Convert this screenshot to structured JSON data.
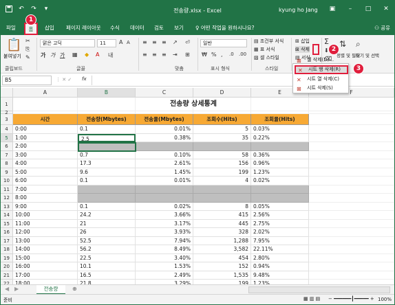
{
  "titlebar": {
    "title": "전송량.xlsx  -  Excel",
    "user": "kyung ho Jang",
    "save_icon": "save-icon",
    "undo_icon": "undo-icon",
    "redo_icon": "redo-icon"
  },
  "tabs": [
    "파일",
    "홈",
    "삽입",
    "페이지 레이아웃",
    "수식",
    "데이터",
    "검토",
    "보기"
  ],
  "tell_me": "어떤 작업을 원하시나요?",
  "share": "공유",
  "ribbon": {
    "paste": "붙여넣기",
    "clipboard": "클립보드",
    "font_name": "맑은 고딕",
    "font_size": "11",
    "font_group": "글꼴",
    "align_group": "맞춤",
    "number_format": "일반",
    "number_group": "표시 형식",
    "cond_format": "조건부 서식",
    "table_format": "표 서식",
    "cell_style": "셀 스타일",
    "style_group": "스타일",
    "insert": "삽입",
    "delete": "삭제",
    "format": "서식",
    "sum": "Σ",
    "sort_filter": "정렬 및 필터",
    "find_select": "찾기 및 선택"
  },
  "delete_menu": {
    "items": [
      "셀 삭제(D)...",
      "시트 행 삭제(R)",
      "시트 열 삭제(C)",
      "시트 삭제(S)"
    ]
  },
  "callouts": [
    "1",
    "2",
    "3"
  ],
  "formula_bar": {
    "name_box": "B5",
    "fx": "fx"
  },
  "columns": [
    "A",
    "B",
    "C",
    "D",
    "E",
    "F"
  ],
  "sheet": {
    "title": "전송량 상세통계",
    "headers": [
      "시간",
      "전송량(Mbytes)",
      "전송율(Mbytes)",
      "조회수(Hits)",
      "조회율(Hits)"
    ],
    "rows": [
      [
        "0:00",
        "0.1",
        "0.01%",
        "5",
        "0.03%"
      ],
      [
        "1:00",
        "2.5",
        "0.38%",
        "35",
        "0.22%"
      ],
      [
        "2:00",
        "",
        "",
        "",
        ""
      ],
      [
        "3:00",
        "0.7",
        "0.10%",
        "58",
        "0.36%"
      ],
      [
        "4:00",
        "17.3",
        "2.61%",
        "156",
        "0.96%"
      ],
      [
        "5:00",
        "9.6",
        "1.45%",
        "199",
        "1.23%"
      ],
      [
        "6:00",
        "0.1",
        "0.01%",
        "4",
        "0.02%"
      ],
      [
        "7:00",
        "",
        "",
        "",
        ""
      ],
      [
        "8:00",
        "",
        "",
        "",
        ""
      ],
      [
        "9:00",
        "0.1",
        "0.02%",
        "8",
        "0.05%"
      ],
      [
        "10:00",
        "24.2",
        "3.66%",
        "415",
        "2.56%"
      ],
      [
        "11:00",
        "21",
        "3.17%",
        "445",
        "2.75%"
      ],
      [
        "12:00",
        "26",
        "3.93%",
        "328",
        "2.02%"
      ],
      [
        "13:00",
        "52.5",
        "7.94%",
        "1,288",
        "7.95%"
      ],
      [
        "14:00",
        "56.2",
        "8.49%",
        "3,582",
        "22.11%"
      ],
      [
        "15:00",
        "22.5",
        "3.40%",
        "454",
        "2.80%"
      ],
      [
        "16:00",
        "10.1",
        "1.53%",
        "152",
        "0.94%"
      ],
      [
        "17:00",
        "16.5",
        "2.49%",
        "1,535",
        "9.48%"
      ],
      [
        "18:00",
        "21.8",
        "3.29%",
        "199",
        "1.23%"
      ]
    ],
    "gray_rows": [
      2,
      7,
      8
    ]
  },
  "sheet_tab": "전송량",
  "status": {
    "left": "준비",
    "zoom": "100%"
  }
}
